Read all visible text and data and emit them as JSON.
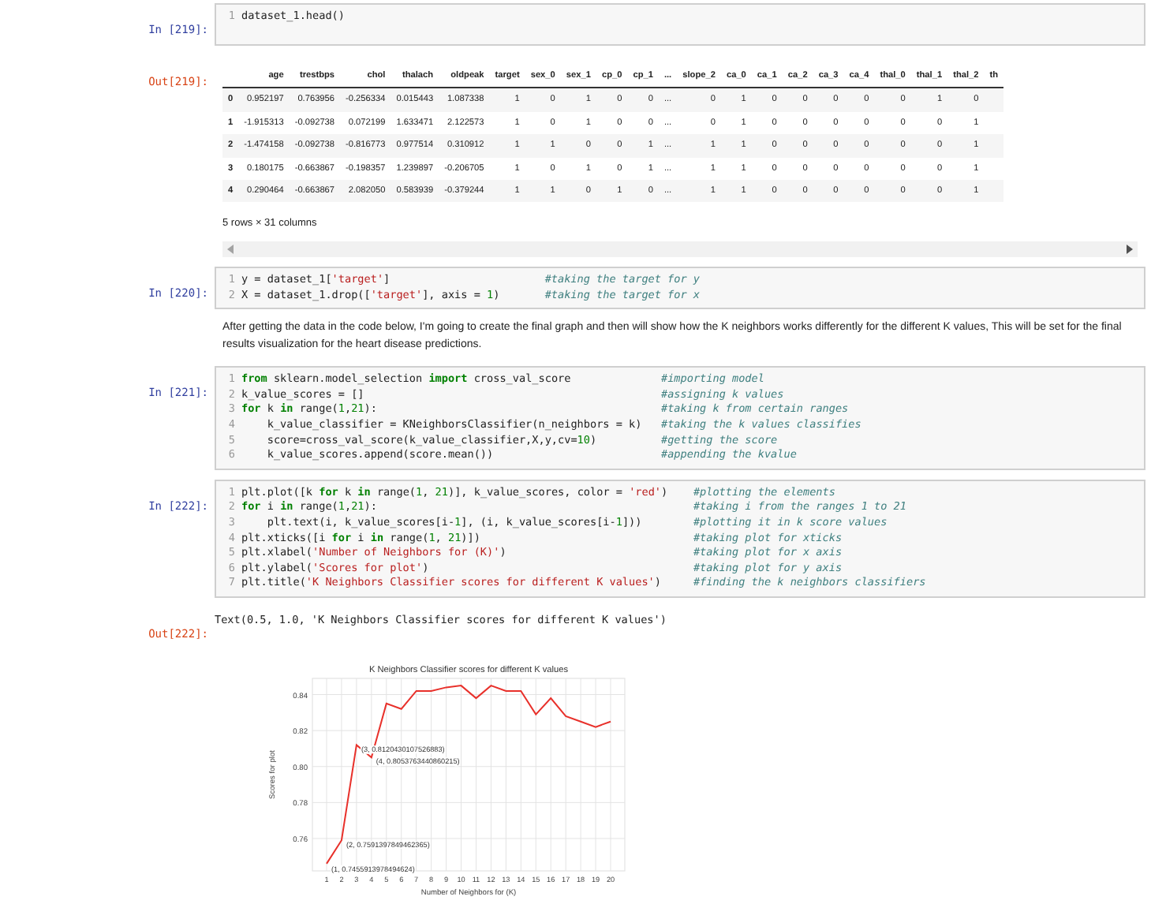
{
  "cells": [
    {
      "kind": "code",
      "prompt": "In [219]:",
      "lines": [
        {
          "num": "1",
          "tokens": [
            {
              "t": "dataset_1.head()",
              "kind": "txt"
            }
          ]
        }
      ]
    },
    {
      "kind": "table_output",
      "prompt": "Out[219]:",
      "columns": [
        "",
        "age",
        "trestbps",
        "chol",
        "thalach",
        "oldpeak",
        "target",
        "sex_0",
        "sex_1",
        "cp_0",
        "cp_1",
        "...",
        "slope_2",
        "ca_0",
        "ca_1",
        "ca_2",
        "ca_3",
        "ca_4",
        "thal_0",
        "thal_1",
        "thal_2",
        "th"
      ],
      "rows": [
        [
          "0",
          "0.952197",
          "0.763956",
          "-0.256334",
          "0.015443",
          "1.087338",
          "1",
          "0",
          "1",
          "0",
          "0",
          "...",
          "0",
          "1",
          "0",
          "0",
          "0",
          "0",
          "0",
          "1",
          "0",
          ""
        ],
        [
          "1",
          "-1.915313",
          "-0.092738",
          "0.072199",
          "1.633471",
          "2.122573",
          "1",
          "0",
          "1",
          "0",
          "0",
          "...",
          "0",
          "1",
          "0",
          "0",
          "0",
          "0",
          "0",
          "0",
          "1",
          ""
        ],
        [
          "2",
          "-1.474158",
          "-0.092738",
          "-0.816773",
          "0.977514",
          "0.310912",
          "1",
          "1",
          "0",
          "0",
          "1",
          "...",
          "1",
          "1",
          "0",
          "0",
          "0",
          "0",
          "0",
          "0",
          "1",
          ""
        ],
        [
          "3",
          "0.180175",
          "-0.663867",
          "-0.198357",
          "1.239897",
          "-0.206705",
          "1",
          "0",
          "1",
          "0",
          "1",
          "...",
          "1",
          "1",
          "0",
          "0",
          "0",
          "0",
          "0",
          "0",
          "1",
          ""
        ],
        [
          "4",
          "0.290464",
          "-0.663867",
          "2.082050",
          "0.583939",
          "-0.379244",
          "1",
          "1",
          "0",
          "1",
          "0",
          "...",
          "1",
          "1",
          "0",
          "0",
          "0",
          "0",
          "0",
          "0",
          "1",
          ""
        ]
      ],
      "caption": "5 rows × 31 columns"
    },
    {
      "kind": "code",
      "prompt": "In [220]:",
      "lines": [
        {
          "num": "1",
          "tokens": [
            {
              "t": "y = dataset_1[",
              "kind": "txt"
            },
            {
              "t": "'target'",
              "kind": "str"
            },
            {
              "t": "]",
              "kind": "txt"
            }
          ],
          "comment": "#taking the target for y"
        },
        {
          "num": "2",
          "tokens": [
            {
              "t": "X = dataset_1.drop([",
              "kind": "txt"
            },
            {
              "t": "'target'",
              "kind": "str"
            },
            {
              "t": "], axis = ",
              "kind": "txt"
            },
            {
              "t": "1",
              "kind": "num"
            },
            {
              "t": ")",
              "kind": "txt"
            }
          ],
          "comment": "#taking the target for x"
        }
      ]
    },
    {
      "kind": "markdown",
      "text": "After getting the data in the code below, I'm going to create the final graph and then will show how the K neighbors works differently for the different K values, This will be set for the final results visualization for the heart disease predictions."
    },
    {
      "kind": "code",
      "prompt": "In [221]:",
      "lines": [
        {
          "num": "1",
          "tokens": [
            {
              "t": "from",
              "kind": "kw"
            },
            {
              "t": " sklearn.model_selection ",
              "kind": "txt"
            },
            {
              "t": "import",
              "kind": "kw"
            },
            {
              "t": " cross_val_score",
              "kind": "txt"
            }
          ],
          "comment": "#importing model"
        },
        {
          "num": "2",
          "tokens": [
            {
              "t": "k_value_scores = []",
              "kind": "txt"
            }
          ],
          "comment": "#assigning k values"
        },
        {
          "num": "3",
          "tokens": [
            {
              "t": "for",
              "kind": "kw"
            },
            {
              "t": " k ",
              "kind": "txt"
            },
            {
              "t": "in",
              "kind": "kw"
            },
            {
              "t": " range(",
              "kind": "txt"
            },
            {
              "t": "1",
              "kind": "num"
            },
            {
              "t": ",",
              "kind": "txt"
            },
            {
              "t": "21",
              "kind": "num"
            },
            {
              "t": "):",
              "kind": "txt"
            }
          ],
          "comment": "#taking k from certain ranges"
        },
        {
          "num": "4",
          "tokens": [
            {
              "t": "    k_value_classifier = KNeighborsClassifier(n_neighbors = k)",
              "kind": "txt"
            }
          ],
          "comment": "#taking the k values classifies"
        },
        {
          "num": "5",
          "tokens": [
            {
              "t": "    score=cross_val_score(k_value_classifier,X,y,cv=",
              "kind": "txt"
            },
            {
              "t": "10",
              "kind": "num"
            },
            {
              "t": ")",
              "kind": "txt"
            }
          ],
          "comment": "#getting the score"
        },
        {
          "num": "6",
          "tokens": [
            {
              "t": "    k_value_scores.append(score.mean())",
              "kind": "txt"
            }
          ],
          "comment": "#appending the kvalue"
        }
      ]
    },
    {
      "kind": "code",
      "prompt": "In [222]:",
      "lines": [
        {
          "num": "1",
          "tokens": [
            {
              "t": "plt.plot([k ",
              "kind": "txt"
            },
            {
              "t": "for",
              "kind": "kw"
            },
            {
              "t": " k ",
              "kind": "txt"
            },
            {
              "t": "in",
              "kind": "kw"
            },
            {
              "t": " range(",
              "kind": "txt"
            },
            {
              "t": "1",
              "kind": "num"
            },
            {
              "t": ", ",
              "kind": "txt"
            },
            {
              "t": "21",
              "kind": "num"
            },
            {
              "t": ")], k_value_scores, color = ",
              "kind": "txt"
            },
            {
              "t": "'red'",
              "kind": "str"
            },
            {
              "t": ")",
              "kind": "txt"
            }
          ],
          "comment": "#plotting the elements"
        },
        {
          "num": "2",
          "tokens": [
            {
              "t": "for",
              "kind": "kw"
            },
            {
              "t": " i ",
              "kind": "txt"
            },
            {
              "t": "in",
              "kind": "kw"
            },
            {
              "t": " range(",
              "kind": "txt"
            },
            {
              "t": "1",
              "kind": "num"
            },
            {
              "t": ",",
              "kind": "txt"
            },
            {
              "t": "21",
              "kind": "num"
            },
            {
              "t": "):",
              "kind": "txt"
            }
          ],
          "comment": "#taking i from the ranges 1 to 21"
        },
        {
          "num": "3",
          "tokens": [
            {
              "t": "    plt.text(i, k_value_scores[i-",
              "kind": "txt"
            },
            {
              "t": "1",
              "kind": "num"
            },
            {
              "t": "], (i, k_value_scores[i-",
              "kind": "txt"
            },
            {
              "t": "1",
              "kind": "num"
            },
            {
              "t": "]))",
              "kind": "txt"
            }
          ],
          "comment": "#plotting it in k score values"
        },
        {
          "num": "4",
          "tokens": [
            {
              "t": "plt.xticks([i ",
              "kind": "txt"
            },
            {
              "t": "for",
              "kind": "kw"
            },
            {
              "t": " i ",
              "kind": "txt"
            },
            {
              "t": "in",
              "kind": "kw"
            },
            {
              "t": " range(",
              "kind": "txt"
            },
            {
              "t": "1",
              "kind": "num"
            },
            {
              "t": ", ",
              "kind": "txt"
            },
            {
              "t": "21",
              "kind": "num"
            },
            {
              "t": ")])",
              "kind": "txt"
            }
          ],
          "comment": "#taking plot for xticks"
        },
        {
          "num": "5",
          "tokens": [
            {
              "t": "plt.xlabel(",
              "kind": "txt"
            },
            {
              "t": "'Number of Neighbors for (K)'",
              "kind": "str"
            },
            {
              "t": ")",
              "kind": "txt"
            }
          ],
          "comment": "#taking plot for x axis"
        },
        {
          "num": "6",
          "tokens": [
            {
              "t": "plt.ylabel(",
              "kind": "txt"
            },
            {
              "t": "'Scores for plot'",
              "kind": "str"
            },
            {
              "t": ")",
              "kind": "txt"
            }
          ],
          "comment": "#taking plot for y axis"
        },
        {
          "num": "7",
          "tokens": [
            {
              "t": "plt.title(",
              "kind": "txt"
            },
            {
              "t": "'K Neighbors Classifier scores for different K values'",
              "kind": "str"
            },
            {
              "t": ")",
              "kind": "txt"
            }
          ],
          "comment": "#finding the k neighbors classifiers"
        }
      ]
    },
    {
      "kind": "text_output",
      "prompt": "Out[222]:",
      "text": "Text(0.5, 1.0, 'K Neighbors Classifier scores for different K values')"
    },
    {
      "kind": "chart_output",
      "chart_data": {
        "type": "line",
        "title": "K Neighbors Classifier scores for different K values",
        "xlabel": "Number of Neighbors for (K)",
        "ylabel": "Scores for plot",
        "x": [
          1,
          2,
          3,
          4,
          5,
          6,
          7,
          8,
          9,
          10,
          11,
          12,
          13,
          14,
          15,
          16,
          17,
          18,
          19,
          20
        ],
        "series": [
          {
            "color": "#e8302a",
            "values": [
              0.746,
              0.759,
              0.812,
              0.805,
              0.835,
              0.832,
              0.842,
              0.842,
              0.844,
              0.845,
              0.838,
              0.845,
              0.842,
              0.842,
              0.829,
              0.838,
              0.828,
              0.825,
              0.822,
              0.825
            ]
          }
        ],
        "xlim": [
          0.05,
          20.95
        ],
        "ylim": [
          0.742,
          0.849
        ],
        "grid": true,
        "xticks": [
          1,
          2,
          3,
          4,
          5,
          6,
          7,
          8,
          9,
          10,
          11,
          12,
          13,
          14,
          15,
          16,
          17,
          18,
          19,
          20
        ],
        "yticks": [
          {
            "value": 0.76,
            "label": "0.76"
          },
          {
            "value": 0.78,
            "label": "0.78"
          },
          {
            "value": 0.8,
            "label": "0.80"
          },
          {
            "value": 0.82,
            "label": "0.82"
          },
          {
            "value": 0.84,
            "label": "0.84"
          }
        ],
        "annotations": [
          {
            "x": 1,
            "y": 0.7456,
            "text": "(1, 0.7455913978494624)"
          },
          {
            "x": 2,
            "y": 0.7591,
            "text": "(2, 0.7591397849462365)"
          },
          {
            "x": 3,
            "y": 0.812,
            "text": "(3, 0.8120430107526883)"
          },
          {
            "x": 4,
            "y": 0.8054,
            "text": "(4, 0.8053763440860215)"
          }
        ]
      }
    }
  ]
}
